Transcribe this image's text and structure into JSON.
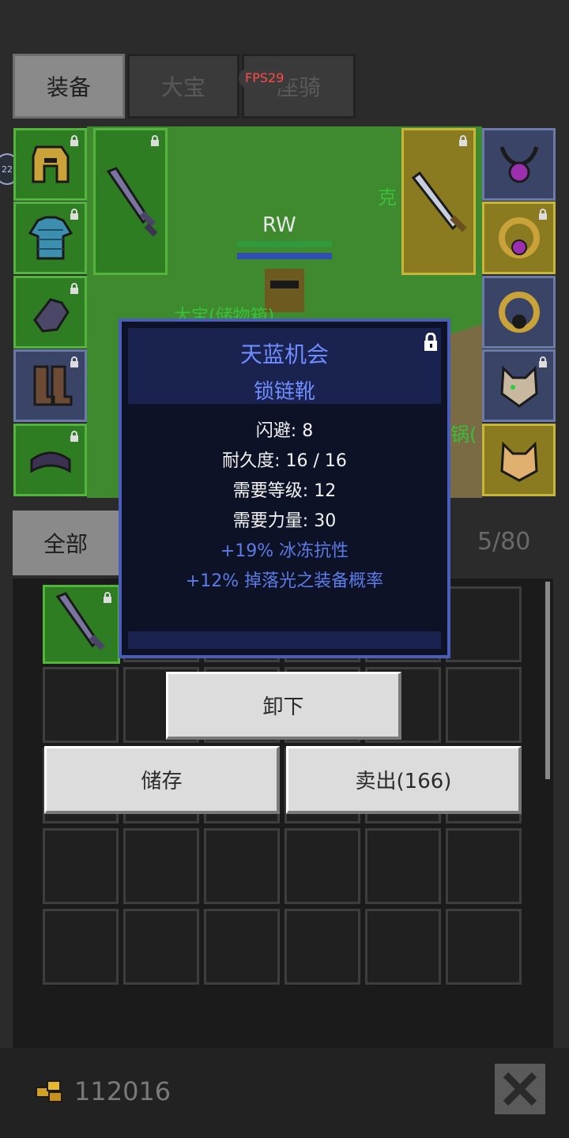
{
  "tabs": {
    "equip": "装备",
    "storage": "大宝",
    "mount": "座骑"
  },
  "fps": "FPS29",
  "scene": {
    "player_name": "RW",
    "side_text_left": "22",
    "label_1": "克",
    "label_2": "锅(",
    "label_3": "大宝(储物箱)"
  },
  "filter": {
    "all": "全部",
    "count": "5/80"
  },
  "tooltip": {
    "title": "天蓝机会",
    "subtitle": "锁链靴",
    "stats": [
      "闪避: 8",
      "耐久度: 16 / 16",
      "需要等级: 12",
      "需要力量: 30"
    ],
    "bonuses": [
      "+19% 冰冻抗性",
      "+12% 掉落光之装备概率"
    ]
  },
  "actions": {
    "unequip": "卸下",
    "store": "储存",
    "sell": "卖出(166)"
  },
  "footer": {
    "gold": "112016"
  },
  "colors": {
    "tooltip_title": "#6f8dff",
    "bonus": "#5b7be6",
    "fps": "#ff4a4a"
  },
  "icons": {
    "gold": "gold-coins-icon",
    "close": "close-x-icon",
    "lock": "lock-icon"
  }
}
